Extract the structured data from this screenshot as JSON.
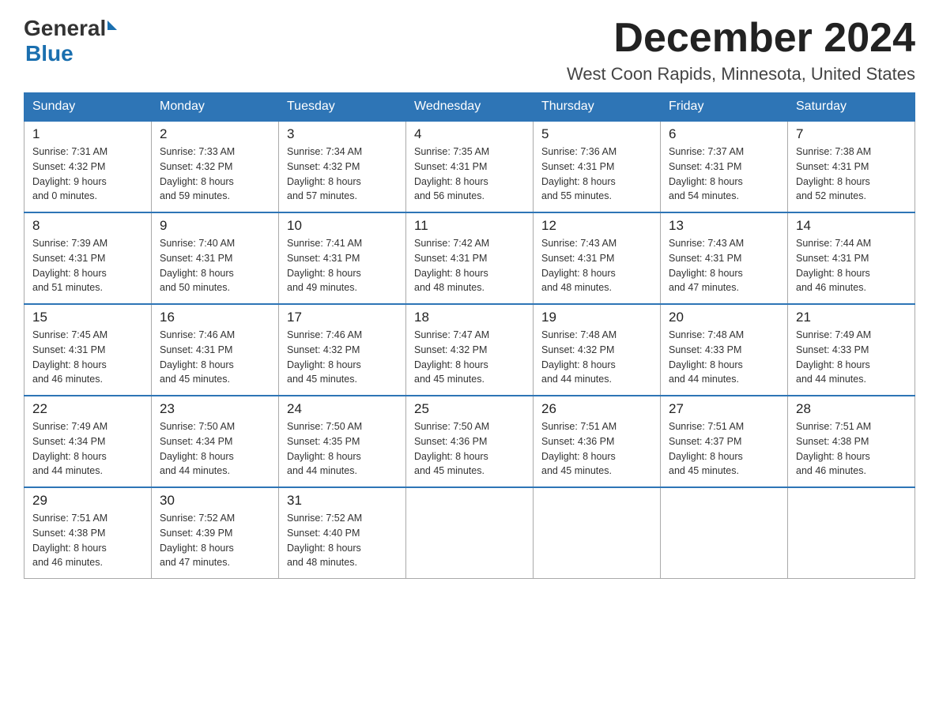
{
  "logo": {
    "text_general": "General",
    "triangle": "▲",
    "text_blue": "Blue"
  },
  "title": {
    "month": "December 2024",
    "location": "West Coon Rapids, Minnesota, United States"
  },
  "weekdays": [
    "Sunday",
    "Monday",
    "Tuesday",
    "Wednesday",
    "Thursday",
    "Friday",
    "Saturday"
  ],
  "weeks": [
    [
      {
        "day": "1",
        "sunrise": "7:31 AM",
        "sunset": "4:32 PM",
        "daylight": "9 hours and 0 minutes."
      },
      {
        "day": "2",
        "sunrise": "7:33 AM",
        "sunset": "4:32 PM",
        "daylight": "8 hours and 59 minutes."
      },
      {
        "day": "3",
        "sunrise": "7:34 AM",
        "sunset": "4:32 PM",
        "daylight": "8 hours and 57 minutes."
      },
      {
        "day": "4",
        "sunrise": "7:35 AM",
        "sunset": "4:31 PM",
        "daylight": "8 hours and 56 minutes."
      },
      {
        "day": "5",
        "sunrise": "7:36 AM",
        "sunset": "4:31 PM",
        "daylight": "8 hours and 55 minutes."
      },
      {
        "day": "6",
        "sunrise": "7:37 AM",
        "sunset": "4:31 PM",
        "daylight": "8 hours and 54 minutes."
      },
      {
        "day": "7",
        "sunrise": "7:38 AM",
        "sunset": "4:31 PM",
        "daylight": "8 hours and 52 minutes."
      }
    ],
    [
      {
        "day": "8",
        "sunrise": "7:39 AM",
        "sunset": "4:31 PM",
        "daylight": "8 hours and 51 minutes."
      },
      {
        "day": "9",
        "sunrise": "7:40 AM",
        "sunset": "4:31 PM",
        "daylight": "8 hours and 50 minutes."
      },
      {
        "day": "10",
        "sunrise": "7:41 AM",
        "sunset": "4:31 PM",
        "daylight": "8 hours and 49 minutes."
      },
      {
        "day": "11",
        "sunrise": "7:42 AM",
        "sunset": "4:31 PM",
        "daylight": "8 hours and 48 minutes."
      },
      {
        "day": "12",
        "sunrise": "7:43 AM",
        "sunset": "4:31 PM",
        "daylight": "8 hours and 48 minutes."
      },
      {
        "day": "13",
        "sunrise": "7:43 AM",
        "sunset": "4:31 PM",
        "daylight": "8 hours and 47 minutes."
      },
      {
        "day": "14",
        "sunrise": "7:44 AM",
        "sunset": "4:31 PM",
        "daylight": "8 hours and 46 minutes."
      }
    ],
    [
      {
        "day": "15",
        "sunrise": "7:45 AM",
        "sunset": "4:31 PM",
        "daylight": "8 hours and 46 minutes."
      },
      {
        "day": "16",
        "sunrise": "7:46 AM",
        "sunset": "4:31 PM",
        "daylight": "8 hours and 45 minutes."
      },
      {
        "day": "17",
        "sunrise": "7:46 AM",
        "sunset": "4:32 PM",
        "daylight": "8 hours and 45 minutes."
      },
      {
        "day": "18",
        "sunrise": "7:47 AM",
        "sunset": "4:32 PM",
        "daylight": "8 hours and 45 minutes."
      },
      {
        "day": "19",
        "sunrise": "7:48 AM",
        "sunset": "4:32 PM",
        "daylight": "8 hours and 44 minutes."
      },
      {
        "day": "20",
        "sunrise": "7:48 AM",
        "sunset": "4:33 PM",
        "daylight": "8 hours and 44 minutes."
      },
      {
        "day": "21",
        "sunrise": "7:49 AM",
        "sunset": "4:33 PM",
        "daylight": "8 hours and 44 minutes."
      }
    ],
    [
      {
        "day": "22",
        "sunrise": "7:49 AM",
        "sunset": "4:34 PM",
        "daylight": "8 hours and 44 minutes."
      },
      {
        "day": "23",
        "sunrise": "7:50 AM",
        "sunset": "4:34 PM",
        "daylight": "8 hours and 44 minutes."
      },
      {
        "day": "24",
        "sunrise": "7:50 AM",
        "sunset": "4:35 PM",
        "daylight": "8 hours and 44 minutes."
      },
      {
        "day": "25",
        "sunrise": "7:50 AM",
        "sunset": "4:36 PM",
        "daylight": "8 hours and 45 minutes."
      },
      {
        "day": "26",
        "sunrise": "7:51 AM",
        "sunset": "4:36 PM",
        "daylight": "8 hours and 45 minutes."
      },
      {
        "day": "27",
        "sunrise": "7:51 AM",
        "sunset": "4:37 PM",
        "daylight": "8 hours and 45 minutes."
      },
      {
        "day": "28",
        "sunrise": "7:51 AM",
        "sunset": "4:38 PM",
        "daylight": "8 hours and 46 minutes."
      }
    ],
    [
      {
        "day": "29",
        "sunrise": "7:51 AM",
        "sunset": "4:38 PM",
        "daylight": "8 hours and 46 minutes."
      },
      {
        "day": "30",
        "sunrise": "7:52 AM",
        "sunset": "4:39 PM",
        "daylight": "8 hours and 47 minutes."
      },
      {
        "day": "31",
        "sunrise": "7:52 AM",
        "sunset": "4:40 PM",
        "daylight": "8 hours and 48 minutes."
      },
      null,
      null,
      null,
      null
    ]
  ],
  "labels": {
    "sunrise": "Sunrise:",
    "sunset": "Sunset:",
    "daylight": "Daylight:"
  }
}
